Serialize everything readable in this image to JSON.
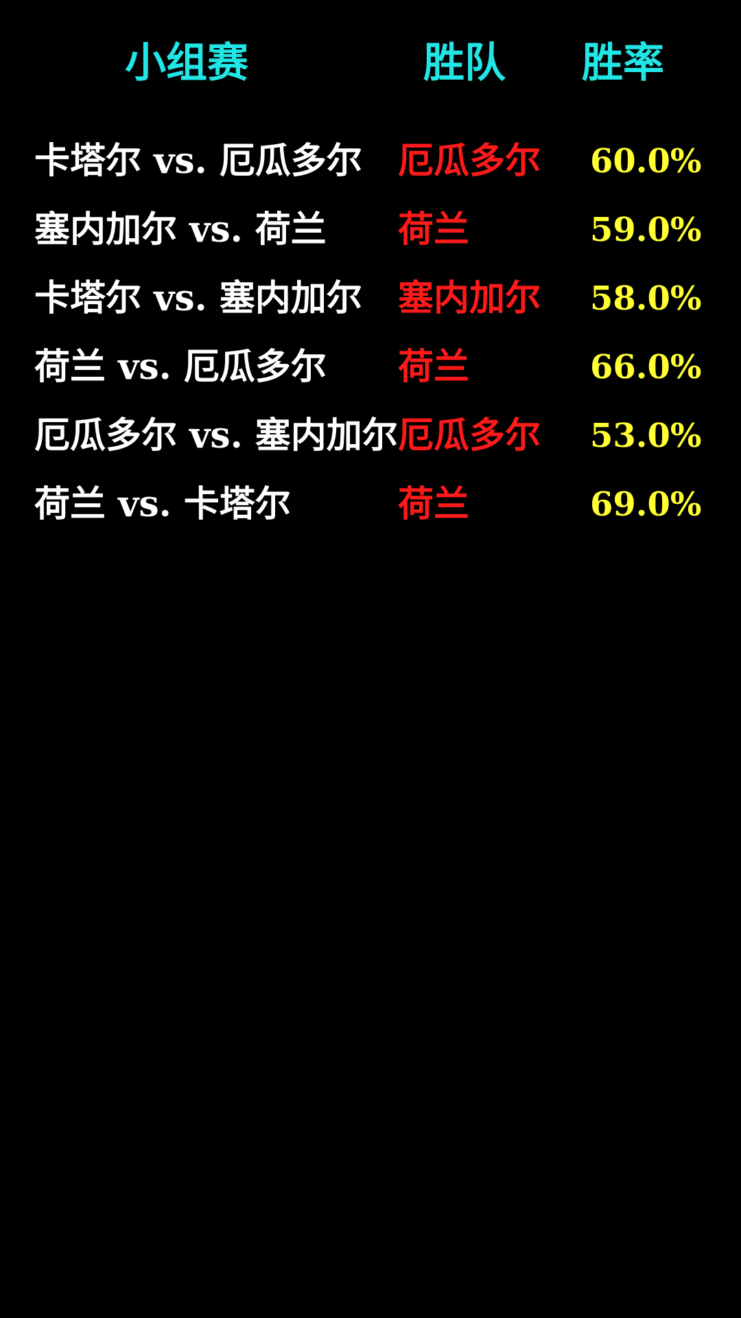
{
  "header": {
    "match_label": "小组赛",
    "winner_label": "胜队",
    "rate_label": "胜率"
  },
  "rows": [
    {
      "match": "卡塔尔 vs. 厄瓜多尔",
      "winner": "厄瓜多尔",
      "rate": "60.0%"
    },
    {
      "match": "塞内加尔 vs. 荷兰",
      "winner": "荷兰",
      "rate": "59.0%"
    },
    {
      "match": "卡塔尔 vs. 塞内加尔",
      "winner": "塞内加尔",
      "rate": "58.0%"
    },
    {
      "match": "荷兰 vs. 厄瓜多尔",
      "winner": "荷兰",
      "rate": "66.0%"
    },
    {
      "match": "厄瓜多尔 vs. 塞内加尔",
      "winner": "厄瓜多尔",
      "rate": "53.0%"
    },
    {
      "match": "荷兰 vs. 卡塔尔",
      "winner": "荷兰",
      "rate": "69.0%"
    }
  ],
  "colors": {
    "background": "#000000",
    "header": "#22e6e6",
    "match": "#ffffff",
    "winner": "#ff1a1a",
    "rate": "#ffff33"
  }
}
